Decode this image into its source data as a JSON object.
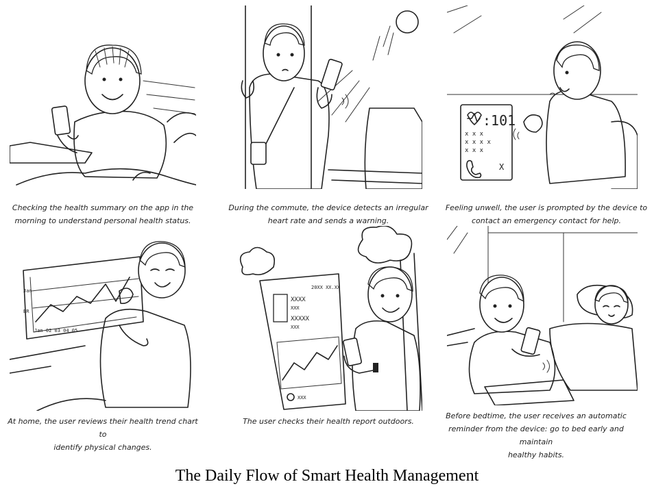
{
  "title": "The Daily Flow of Smart Health Management",
  "panels": [
    {
      "caption_line1": "Checking the health summary on the app in the",
      "caption_line2": "morning to understand personal health status."
    },
    {
      "caption_line1": "During the commute, the device detects an irregular",
      "caption_line2": "heart rate and sends a warning."
    },
    {
      "caption_line1": "Feeling unwell, the user is prompted by the device to",
      "caption_line2": "contact an emergency contact for help."
    },
    {
      "caption_line1": "At home, the user reviews their health trend chart to",
      "caption_line2": "identify physical changes."
    },
    {
      "caption_line1": "The user checks their health report outdoors.",
      "caption_line2": ""
    },
    {
      "caption_line1": "Before bedtime, the user receives an automatic",
      "caption_line2": "reminder from the device: go to bed early and maintain",
      "caption_line3": "healthy habits."
    }
  ],
  "screen_text": {
    "heart_rate": ":101",
    "marks_row1": "x x x",
    "marks_row2": "x x x x",
    "marks_row3": "x x x",
    "decline_mark": "X",
    "chart_label_top": "Jan",
    "chart_label_mid": "BR",
    "chart_axis": "Jan  02   03   04   05",
    "phone_header": "20XX XX.XX",
    "phone_row1": "XXXX",
    "phone_row2": "XXX",
    "phone_row3": "XXXXX",
    "phone_row4": "XXX",
    "phone_footer": "XXX"
  }
}
